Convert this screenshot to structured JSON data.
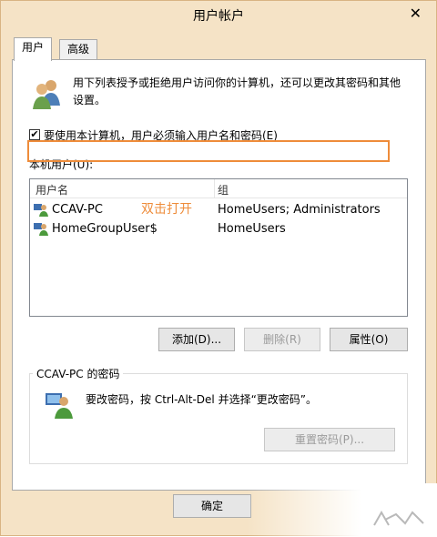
{
  "window": {
    "title": "用户帐户",
    "close_glyph": "✕"
  },
  "tabs": [
    {
      "label": "用户",
      "active": true
    },
    {
      "label": "高级",
      "active": false
    }
  ],
  "intro": {
    "icon": "users-icon",
    "text": "用下列表授予或拒绝用户访问你的计算机，还可以更改其密码和其他设置。"
  },
  "require_password": {
    "checked": true,
    "check_glyph": "✔",
    "label": "要使用本计算机，用户必须输入用户名和密码(E)"
  },
  "local_users": {
    "label": "本机用户(U):",
    "columns": [
      "用户名",
      "组"
    ],
    "rows": [
      {
        "name": "CCAV-PC",
        "group": "HomeUsers; Administrators",
        "icon": "user-icon"
      },
      {
        "name": "HomeGroupUser$",
        "group": "HomeUsers",
        "icon": "user-icon"
      }
    ],
    "annotation": "双击打开"
  },
  "buttons": {
    "add": "添加(D)...",
    "remove": "删除(R)",
    "properties": "属性(O)"
  },
  "password_group": {
    "title": "CCAV-PC 的密码",
    "icon": "user-password-icon",
    "text": "要改密码，按 Ctrl-Alt-Del 并选择“更改密码”。",
    "reset_button": "重置密码(P)..."
  },
  "footer": {
    "ok": "确定"
  },
  "colors": {
    "window_frame": "#f5e3c6",
    "highlight": "#ee8c3a"
  }
}
